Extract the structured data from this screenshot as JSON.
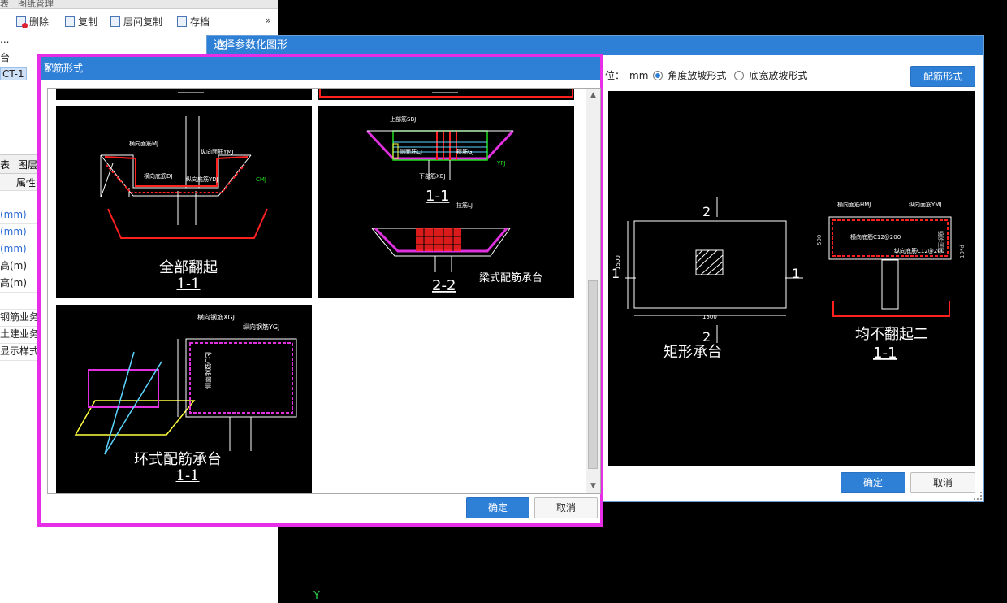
{
  "left_panel": {
    "tabs": [
      "表",
      "图纸管理"
    ],
    "toolbar": {
      "delete": "删除",
      "copy": "复制",
      "floor_copy": "层间复制",
      "archive": "存档",
      "more": "»"
    },
    "tree": [
      "...",
      "台",
      "CT-1"
    ],
    "tabs2": [
      "表",
      "图层"
    ],
    "prop_header": "属性名",
    "props": [
      "(mm)",
      "(mm)",
      "(mm)",
      "高(m)",
      "高(m)",
      "",
      "钢筋业务属",
      "土建业务属",
      "显示样式"
    ]
  },
  "param_dialog": {
    "title": "选择参数化图形",
    "maximize": "□",
    "close": "✕",
    "unit_label": "位：",
    "unit_value": "mm",
    "radio1": "角度放坡形式",
    "radio2": "底宽放坡形式",
    "rebar_button": "配筋形式",
    "ok": "确定",
    "cancel": "取消",
    "preview": {
      "left_caption": "矩形承台",
      "right_caption": "均不翻起二",
      "section": "1-1",
      "mark_top": "2",
      "mark_bottom": "2",
      "mark_left": "1",
      "mark_right": "1",
      "dim_width": "1500",
      "dim_height": "1500",
      "lbl_hmj": "横向面筋HMJ",
      "lbl_ymj": "纵向面筋YMJ",
      "lbl_hdj": "横向底筋C12@200",
      "lbl_ydj": "纵向底筋C12@200",
      "lbl_500": "500",
      "lbl_10d": "10*d",
      "lbl_cmj": "侧面钢筋"
    }
  },
  "rebar_dialog": {
    "title": "配筋形式",
    "close": "×",
    "ok": "确定",
    "cancel": "取消",
    "thumb1": {
      "caption": "全部翻起",
      "sub": "1-1",
      "hmj": "横向面筋MJ",
      "ymj": "纵向面筋YMJ",
      "hdj": "横向底筋DJ",
      "ydj": "纵向底筋YDJ",
      "cmj": "CMJ"
    },
    "thumb2": {
      "caption": "梁式配筋承台",
      "sub1": "1-1",
      "sub2": "2-2",
      "sbj": "上部筋SBJ",
      "cj": "侧面筋CJ",
      "gj": "箍筋GJ",
      "xbj": "下部筋XBJ",
      "lj": "拉筋LJ",
      "ypj": "YPJ"
    },
    "thumb3": {
      "caption": "环式配筋承台",
      "sub": "1-1",
      "xgj": "横向钢筋XGJ",
      "ygj": "纵向钢筋YGJ",
      "cgj": "侧面钢筋CGJ"
    }
  },
  "canvas": {
    "axis_y": "Y"
  },
  "colors": {
    "accent": "#2e7fd6",
    "highlight": "#e62ee6",
    "cad_red": "#ff2020",
    "cad_green": "#20e020",
    "cad_magenta": "#e030e0"
  }
}
